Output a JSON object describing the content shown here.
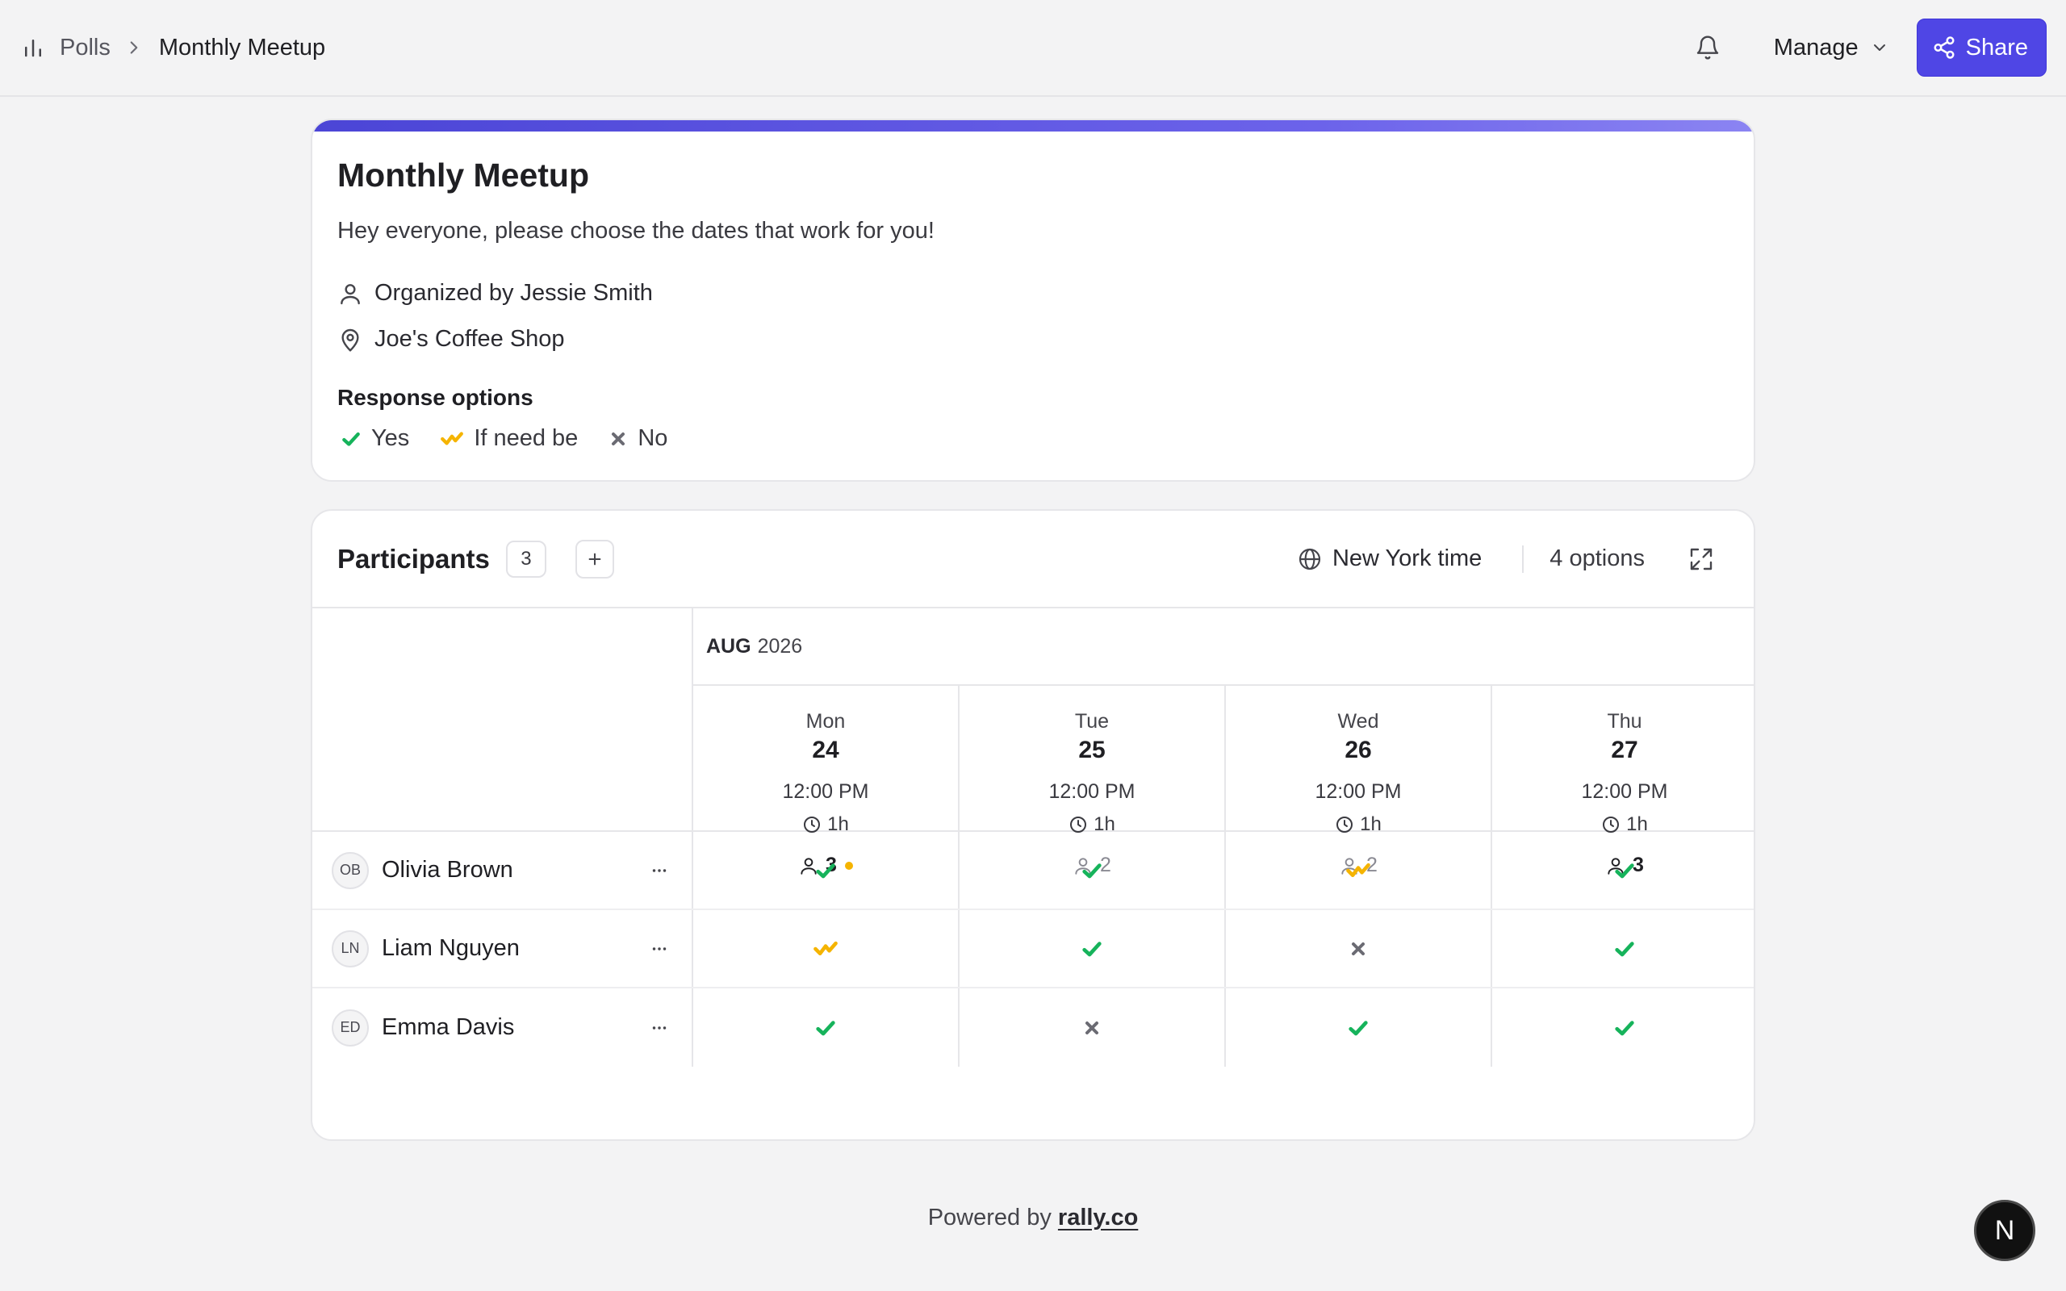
{
  "topbar": {
    "polls_label": "Polls",
    "current_label": "Monthly Meetup",
    "manage_label": "Manage",
    "share_label": "Share"
  },
  "poll": {
    "title": "Monthly Meetup",
    "description": "Hey everyone, please choose the dates that work for you!",
    "organizer": "Organized by Jessie Smith",
    "location": "Joe's Coffee Shop",
    "response_title": "Response options",
    "responses": {
      "yes": "Yes",
      "ifneed": "If need be",
      "no": "No"
    }
  },
  "participants": {
    "title": "Participants",
    "count": "3",
    "timezone": "New York time",
    "options_count": "4 options",
    "month": "AUG",
    "year": "2026",
    "columns": [
      {
        "dow": "Mon",
        "day": "24",
        "time": "12:00 PM",
        "duration": "1h",
        "count": "3"
      },
      {
        "dow": "Tue",
        "day": "25",
        "time": "12:00 PM",
        "duration": "1h",
        "count": "2"
      },
      {
        "dow": "Wed",
        "day": "26",
        "time": "12:00 PM",
        "duration": "1h",
        "count": "2"
      },
      {
        "dow": "Thu",
        "day": "27",
        "time": "12:00 PM",
        "duration": "1h",
        "count": "3"
      }
    ],
    "rows": [
      {
        "initials": "OB",
        "name": "Olivia Brown",
        "votes": [
          "yes",
          "yes",
          "ifneed",
          "yes"
        ]
      },
      {
        "initials": "LN",
        "name": "Liam Nguyen",
        "votes": [
          "ifneed",
          "yes",
          "no",
          "yes"
        ]
      },
      {
        "initials": "ED",
        "name": "Emma Davis",
        "votes": [
          "yes",
          "no",
          "yes",
          "yes"
        ]
      }
    ]
  },
  "footer": {
    "prefix": "Powered by",
    "link": "rally.co"
  },
  "fab_label": "N",
  "colors": {
    "accent": "#4f46e5",
    "yes": "#16b35b",
    "ifneed": "#f5b400",
    "no": "#6b6b73"
  }
}
